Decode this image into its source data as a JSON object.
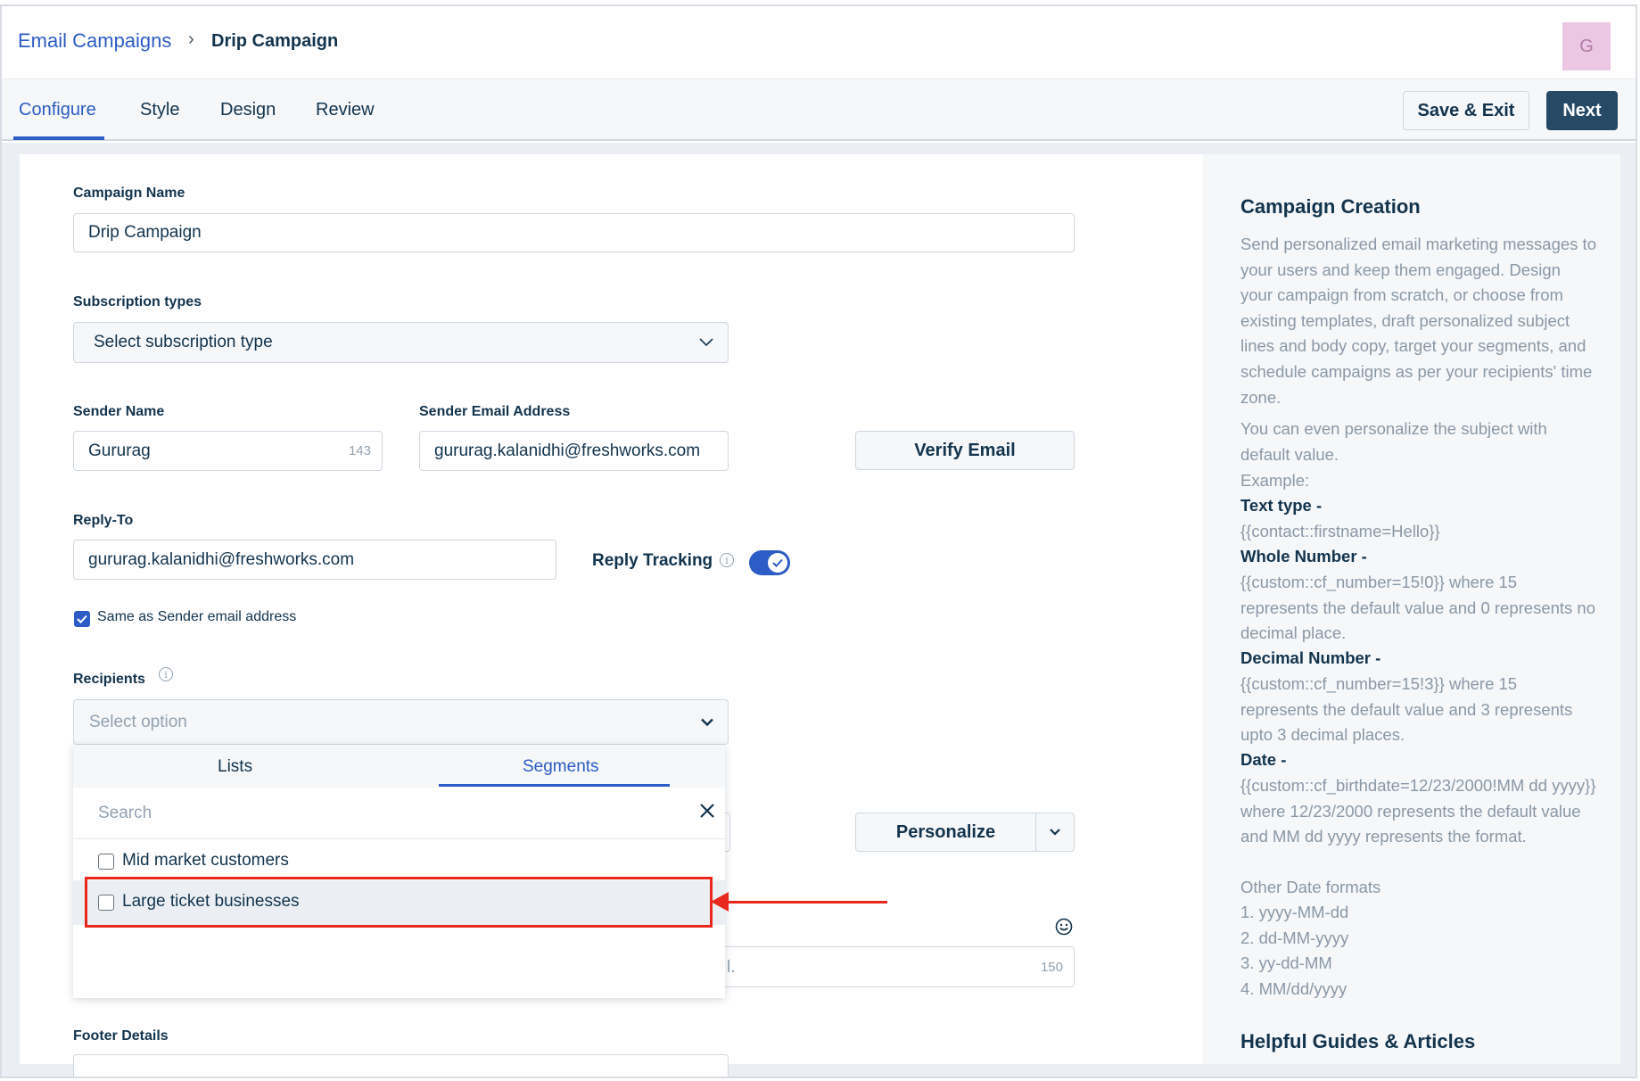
{
  "breadcrumb": {
    "parent": "Email Campaigns",
    "separator": "›",
    "current": "Drip Campaign"
  },
  "avatar": {
    "initial": "G",
    "color": "#ebc7e3"
  },
  "tabs": [
    {
      "label": "Configure",
      "active": true
    },
    {
      "label": "Style",
      "active": false
    },
    {
      "label": "Design",
      "active": false
    },
    {
      "label": "Review",
      "active": false
    }
  ],
  "actions": {
    "save_exit": "Save & Exit",
    "next": "Next"
  },
  "form": {
    "campaign_name": {
      "label": "Campaign Name",
      "value": "Drip Campaign"
    },
    "subscription": {
      "label": "Subscription types",
      "value": "Select subscription type"
    },
    "sender_name": {
      "label": "Sender Name",
      "value": "Gururag",
      "counter": "143"
    },
    "sender_email": {
      "label": "Sender Email Address",
      "value": "gururag.kalanidhi@freshworks.com"
    },
    "verify_button": "Verify Email",
    "reply_to": {
      "label": "Reply-To",
      "value": "gururag.kalanidhi@freshworks.com"
    },
    "reply_tracking": {
      "label": "Reply Tracking",
      "enabled": true
    },
    "same_as_sender": {
      "label": "Same as Sender email address",
      "checked": true
    },
    "recipients": {
      "label": "Recipients",
      "placeholder": "Select option"
    },
    "personalize_button": "Personalize",
    "obscured_field_tail": "l.",
    "subject_counter": "150",
    "footer": {
      "label": "Footer Details"
    }
  },
  "recipients_dropdown": {
    "tabs": [
      {
        "label": "Lists",
        "active": false
      },
      {
        "label": "Segments",
        "active": true
      }
    ],
    "search_placeholder": "Search",
    "items": [
      {
        "label": "Mid market customers",
        "checked": false
      },
      {
        "label": "Large ticket businesses",
        "checked": false,
        "highlighted": true
      }
    ]
  },
  "side_panel": {
    "title": "Campaign Creation",
    "intro": "Send personalized email marketing messages to your users and keep them engaged. Design your campaign from scratch, or choose from existing templates, draft personalized subject lines and body copy, target your segments, and schedule campaigns as per your recipients' time zone.",
    "personalize_note": "You can even personalize the subject with default value.",
    "example_label": "Example:",
    "text_type_title": "Text type -",
    "text_type_example": "{{contact::firstname=Hello}}",
    "whole_number_title": "Whole Number -",
    "whole_number_example": "{{custom::cf_number=15!0}} where 15 represents the default value and 0 represents no decimal place.",
    "decimal_number_title": "Decimal Number -",
    "decimal_number_example": "{{custom::cf_number=15!3}} where 15 represents the default value and 3 represents upto 3 decimal places.",
    "date_title": "Date -",
    "date_example": "{{custom::cf_birthdate=12/23/2000!MM dd yyyy}} where 12/23/2000 represents the default value and MM dd yyyy represents the format.",
    "other_formats_label": "Other Date formats",
    "date_formats": [
      "1. yyyy-MM-dd",
      "2. dd-MM-yyyy",
      "3. yy-dd-MM",
      "4. MM/dd/yyyy"
    ],
    "guides_title": "Helpful Guides & Articles"
  },
  "colors": {
    "accent": "#2c5cc5",
    "primary_button": "#264966",
    "annotation": "#e8281d"
  }
}
